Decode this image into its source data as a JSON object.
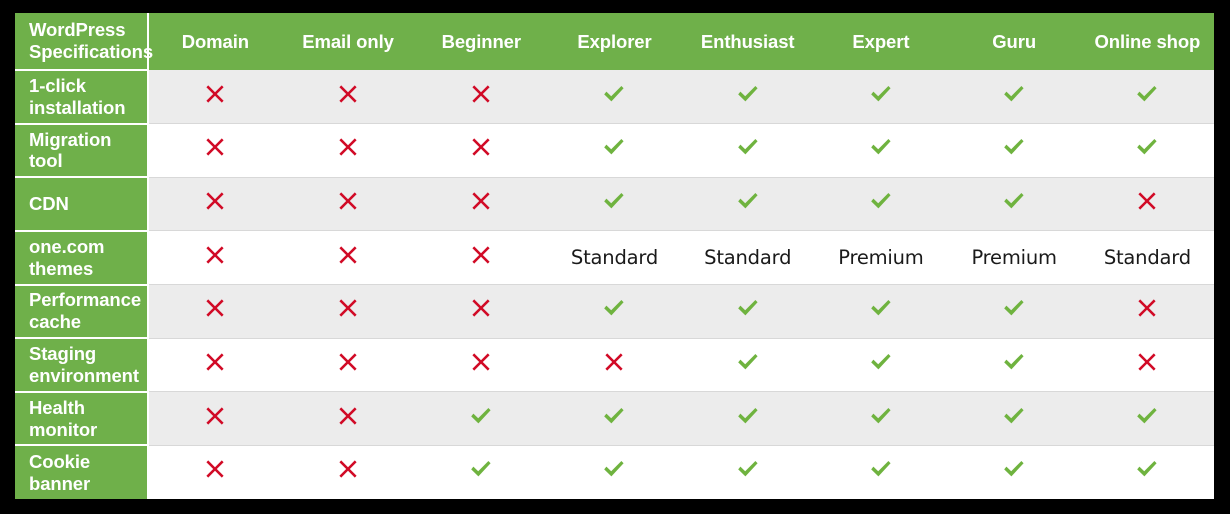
{
  "table": {
    "title_header": "WordPress Specifications",
    "columns": [
      "Domain",
      "Email only",
      "Beginner",
      "Explorer",
      "Enthusiast",
      "Expert",
      "Guru",
      "Online shop"
    ],
    "rows": [
      {
        "label": "1-click installation",
        "values": [
          "cross",
          "cross",
          "cross",
          "check",
          "check",
          "check",
          "check",
          "check"
        ]
      },
      {
        "label": "Migration tool",
        "values": [
          "cross",
          "cross",
          "cross",
          "check",
          "check",
          "check",
          "check",
          "check"
        ]
      },
      {
        "label": "CDN",
        "values": [
          "cross",
          "cross",
          "cross",
          "check",
          "check",
          "check",
          "check",
          "cross"
        ]
      },
      {
        "label": "one.com themes",
        "values": [
          "cross",
          "cross",
          "cross",
          "Standard",
          "Standard",
          "Premium",
          "Premium",
          "Standard"
        ]
      },
      {
        "label": "Performance cache",
        "values": [
          "cross",
          "cross",
          "cross",
          "check",
          "check",
          "check",
          "check",
          "cross"
        ]
      },
      {
        "label": "Staging environment",
        "values": [
          "cross",
          "cross",
          "cross",
          "cross",
          "check",
          "check",
          "check",
          "cross"
        ]
      },
      {
        "label": "Health monitor",
        "values": [
          "cross",
          "cross",
          "check",
          "check",
          "check",
          "check",
          "check",
          "check"
        ]
      },
      {
        "label": "Cookie banner",
        "values": [
          "cross",
          "cross",
          "check",
          "check",
          "check",
          "check",
          "check",
          "check"
        ]
      }
    ]
  },
  "icons": {
    "cross": "cross-icon",
    "check": "check-icon"
  },
  "colors": {
    "brand_green": "#6fb04a",
    "check_green": "#6fb33f",
    "cross_red": "#d10a26",
    "stripe_gray": "#ececec",
    "page_background": "#000000"
  }
}
